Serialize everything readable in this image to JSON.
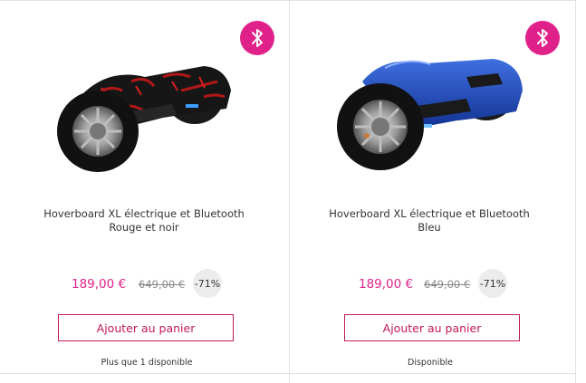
{
  "products": [
    {
      "title_line1": "Hoverboard XL électrique et Bluetooth",
      "title_line2": "Rouge et noir",
      "price": "189,00 €",
      "old_price": "649,00 €",
      "discount": "-71%",
      "add_to_cart_label": "Ajouter au panier",
      "availability": "Plus que 1 disponible",
      "badge_icon": "bluetooth-icon",
      "image": "hoverboard-red-black"
    },
    {
      "title_line1": "Hoverboard XL électrique et Bluetooth",
      "title_line2": "Bleu",
      "price": "189,00 €",
      "old_price": "649,00 €",
      "discount": "-71%",
      "add_to_cart_label": "Ajouter au panier",
      "availability": "Disponible",
      "badge_icon": "bluetooth-icon",
      "image": "hoverboard-blue"
    }
  ],
  "colors": {
    "accent": "#e0218a",
    "button_border": "#c2185b",
    "discount_bg": "#ececec"
  }
}
